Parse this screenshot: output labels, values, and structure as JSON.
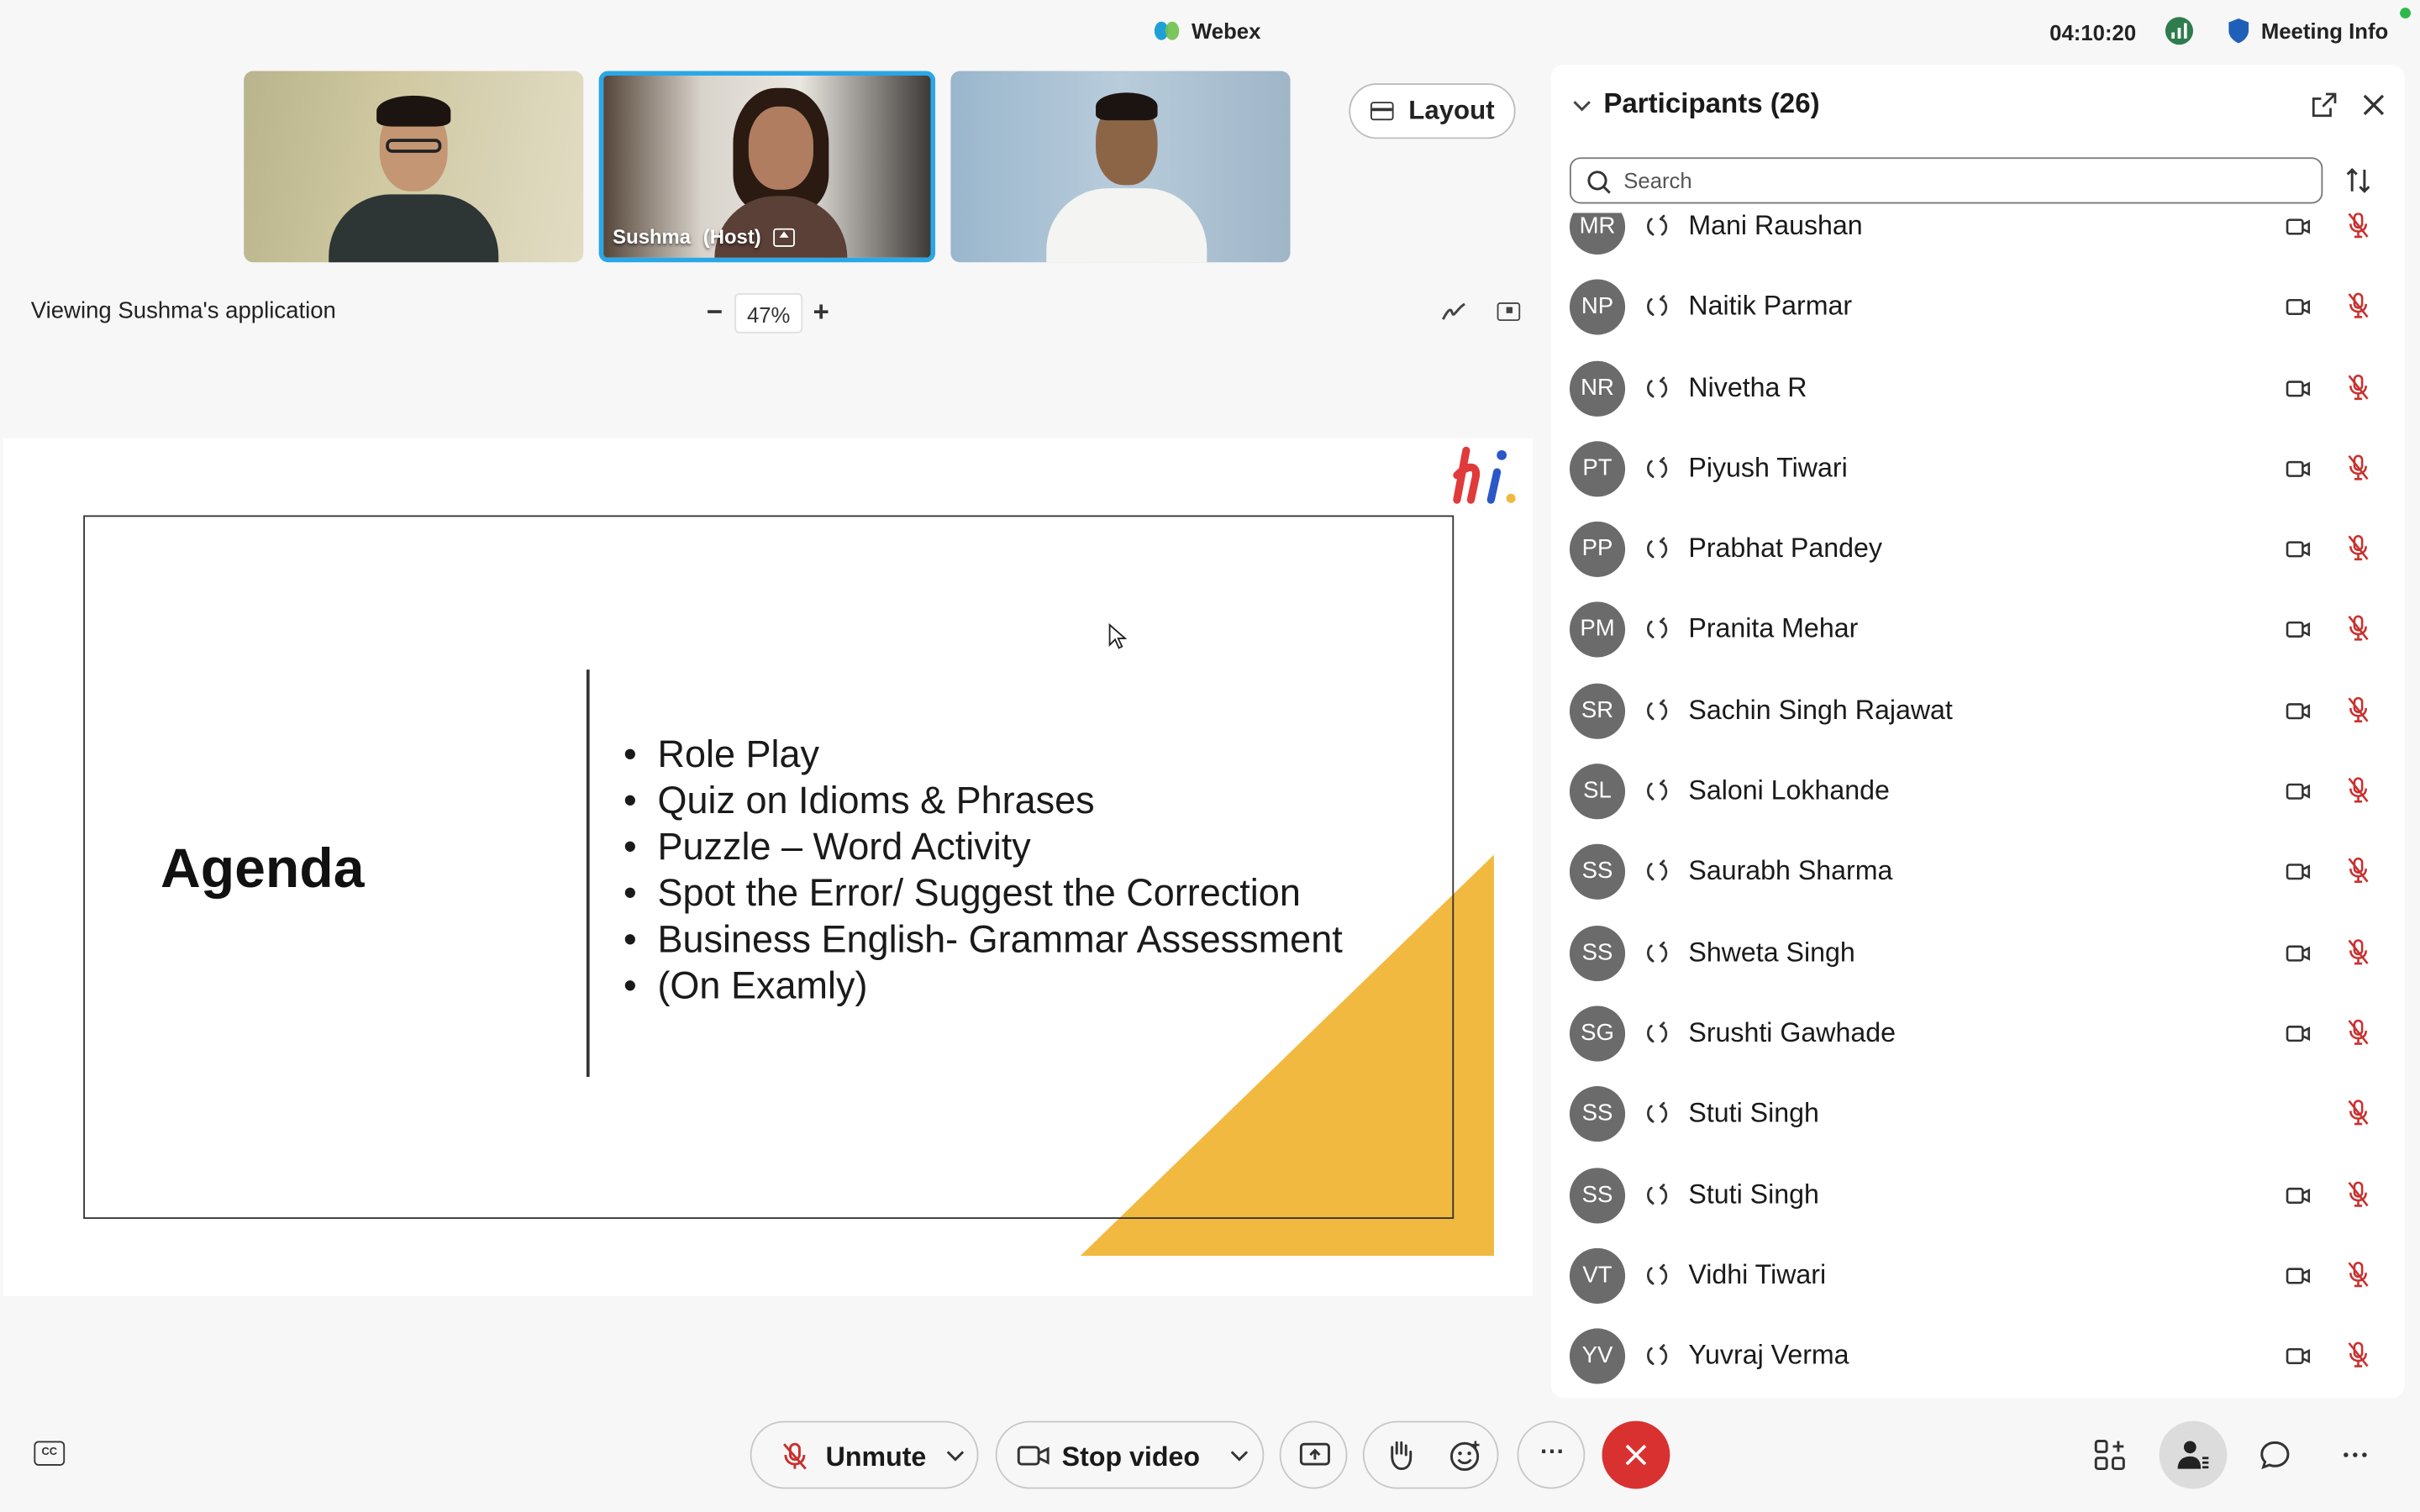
{
  "window": {
    "app_title": "Webex",
    "clock": "04:10:20",
    "meeting_info_label": "Meeting Info"
  },
  "videos": [
    {
      "name": "",
      "host": false
    },
    {
      "name": "Sushma",
      "host_label": "(Host)",
      "host": true,
      "active_speaker": true
    },
    {
      "name": "",
      "host": false
    }
  ],
  "toolbar": {
    "layout_label": "Layout",
    "viewing_text": "Viewing Sushma's application",
    "zoom_minus": "−",
    "zoom_value": "47%",
    "zoom_plus": "+"
  },
  "slide": {
    "title": "Agenda",
    "items": [
      "Role Play",
      "Quiz on Idioms & Phrases",
      "Puzzle – Word Activity",
      "Spot the Error/ Suggest the Correction",
      "Business English- Grammar Assessment",
      "(On Examly)"
    ],
    "logo_text": "hi",
    "accent_color": "#f2b940"
  },
  "participants_panel": {
    "title": "Participants (26)",
    "search_placeholder": "Search",
    "participants": [
      {
        "initials": "MR",
        "name": "Mani Raushan",
        "camera": true,
        "muted": true
      },
      {
        "initials": "NP",
        "name": "Naitik Parmar",
        "camera": true,
        "muted": true
      },
      {
        "initials": "NR",
        "name": "Nivetha R",
        "camera": true,
        "muted": true
      },
      {
        "initials": "PT",
        "name": "Piyush Tiwari",
        "camera": true,
        "muted": true
      },
      {
        "initials": "PP",
        "name": "Prabhat Pandey",
        "camera": true,
        "muted": true
      },
      {
        "initials": "PM",
        "name": "Pranita Mehar",
        "camera": true,
        "muted": true
      },
      {
        "initials": "SR",
        "name": "Sachin Singh Rajawat",
        "camera": true,
        "muted": true
      },
      {
        "initials": "SL",
        "name": "Saloni Lokhande",
        "camera": true,
        "muted": true
      },
      {
        "initials": "SS",
        "name": "Saurabh Sharma",
        "camera": true,
        "muted": true
      },
      {
        "initials": "SS",
        "name": "Shweta Singh",
        "camera": true,
        "muted": true
      },
      {
        "initials": "SG",
        "name": "Srushti Gawhade",
        "camera": true,
        "muted": true
      },
      {
        "initials": "SS",
        "name": "Stuti Singh",
        "camera": false,
        "muted": true
      },
      {
        "initials": "SS",
        "name": "Stuti Singh",
        "camera": true,
        "muted": true
      },
      {
        "initials": "VT",
        "name": "Vidhi Tiwari",
        "camera": true,
        "muted": true
      },
      {
        "initials": "YV",
        "name": "Yuvraj Verma",
        "camera": true,
        "muted": true
      }
    ]
  },
  "controls": {
    "unmute_label": "Unmute",
    "stop_video_label": "Stop video",
    "more_label": "···",
    "end_color": "#d8312f",
    "muted_color": "#c8312f"
  }
}
